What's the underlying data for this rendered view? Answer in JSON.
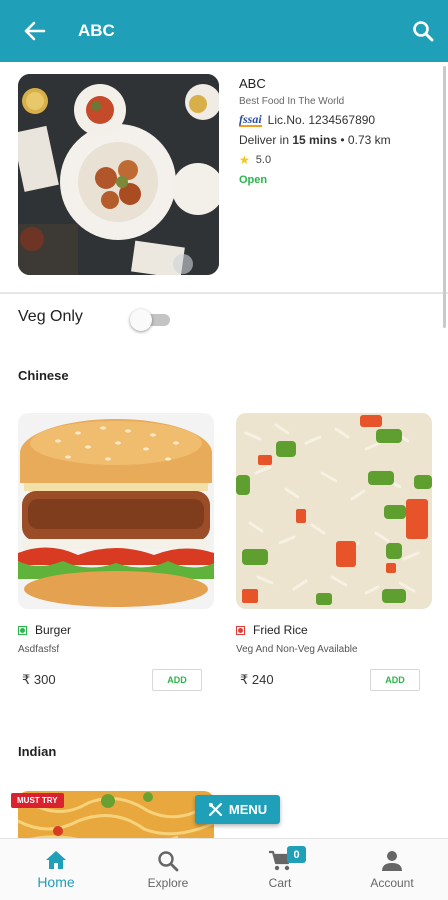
{
  "header": {
    "title": "ABC",
    "back_icon": "arrow-left-icon",
    "search_icon": "search-icon"
  },
  "restaurant": {
    "name": "ABC",
    "tagline": "Best Food In The World",
    "fssai_logo": "fssai",
    "license": "Lic.No. 1234567890",
    "deliver_prefix": "Deliver in ",
    "deliver_time": "15 mins",
    "deliver_distance": " • 0.73 km",
    "rating": "5.0",
    "status": "Open"
  },
  "filters": {
    "veg_only_label": "Veg Only",
    "veg_only_on": false
  },
  "categories": [
    {
      "name": "Chinese",
      "items": [
        {
          "name": "Burger",
          "description": "Asdfasfsf",
          "price": "₹ 300",
          "add_label": "ADD",
          "type": "veg"
        },
        {
          "name": "Fried Rice",
          "description": "Veg And Non-Veg Available",
          "price": "₹ 240",
          "add_label": "ADD",
          "type": "non-veg"
        }
      ]
    },
    {
      "name": "Indian",
      "badge": "MUST TRY"
    }
  ],
  "fab": {
    "label": "MENU",
    "icon": "fork-knife-icon"
  },
  "bottom_nav": [
    {
      "label": "Home",
      "icon": "home-icon",
      "active": true
    },
    {
      "label": "Explore",
      "icon": "search-icon"
    },
    {
      "label": "Cart",
      "icon": "cart-icon",
      "badge": "0"
    },
    {
      "label": "Account",
      "icon": "person-icon"
    }
  ],
  "colors": {
    "primary": "#1f9fb8",
    "veg": "#2bb54a",
    "non_veg": "#e53935",
    "must_try": "#d9212f"
  }
}
